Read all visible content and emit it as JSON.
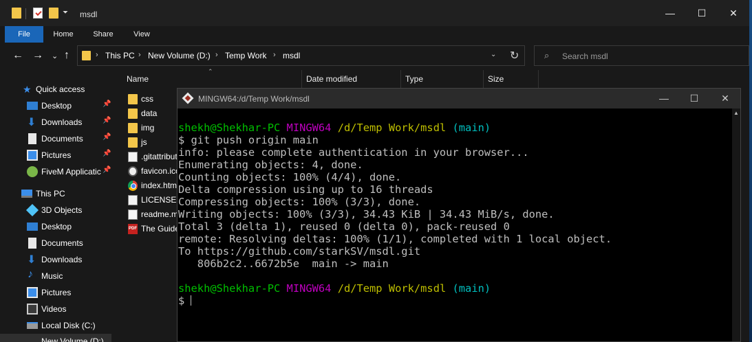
{
  "explorer": {
    "title": "msdl",
    "window_controls": [
      "—",
      "☐",
      "✕"
    ],
    "ribbon_tabs": [
      "File",
      "Home",
      "Share",
      "View"
    ],
    "address": {
      "crumbs": [
        "This PC",
        "New Volume (D:)",
        "Temp Work",
        "msdl"
      ],
      "separator": "›",
      "dropdown": "⌄",
      "refresh": "↻"
    },
    "nav_buttons": {
      "back": "←",
      "forward": "→",
      "recent": "⌄",
      "up": "↑"
    },
    "search": {
      "placeholder": "Search msdl",
      "icon": "search-icon"
    },
    "nav_pane": {
      "pinned": [
        "Quick access",
        "Desktop",
        "Downloads",
        "Documents",
        "Pictures",
        "FiveM Applicatic"
      ],
      "this_pc": [
        "This PC",
        "3D Objects",
        "Desktop",
        "Documents",
        "Downloads",
        "Music",
        "Pictures",
        "Videos",
        "Local Disk (C:)",
        "New Volume (D:)"
      ]
    },
    "columns": [
      "Name",
      "Date modified",
      "Type",
      "Size"
    ],
    "files": [
      {
        "name": "css",
        "icon": "folder-icon"
      },
      {
        "name": "data",
        "icon": "folder-icon"
      },
      {
        "name": "img",
        "icon": "folder-icon"
      },
      {
        "name": "js",
        "icon": "folder-icon"
      },
      {
        "name": ".gitattributes",
        "icon": "document-icon"
      },
      {
        "name": "favicon.ico",
        "icon": "ico-file-icon"
      },
      {
        "name": "index.html",
        "icon": "chrome-icon"
      },
      {
        "name": "LICENSE",
        "icon": "document-icon"
      },
      {
        "name": "readme.md",
        "icon": "document-icon"
      },
      {
        "name": "The Guide.pdf",
        "icon": "pdf-icon"
      }
    ]
  },
  "terminal": {
    "title": "MINGW64:/d/Temp Work/msdl",
    "controls": [
      "—",
      "☐",
      "✕"
    ],
    "prompt": {
      "user": "shekh@Shekhar-PC",
      "system": "MINGW64",
      "path": "/d/Temp Work/msdl",
      "branch": "(main)"
    },
    "output_lines": [
      "$ git push origin main",
      "info: please complete authentication in your browser...",
      "Enumerating objects: 4, done.",
      "Counting objects: 100% (4/4), done.",
      "Delta compression using up to 16 threads",
      "Compressing objects: 100% (3/3), done.",
      "Writing objects: 100% (3/3), 34.43 KiB | 34.43 MiB/s, done.",
      "Total 3 (delta 1), reused 0 (delta 0), pack-reused 0",
      "remote: Resolving deltas: 100% (1/1), completed with 1 local object.",
      "To https://github.com/starkSV/msdl.git",
      "   806b2c2..6672b5e  main -> main"
    ],
    "final_prompt_symbol": "$",
    "colors": {
      "green": "#00bf00",
      "purple": "#bf00bf",
      "yellow": "#bfbf00",
      "cyan": "#00bfbf",
      "text": "#bfbfbf"
    }
  }
}
